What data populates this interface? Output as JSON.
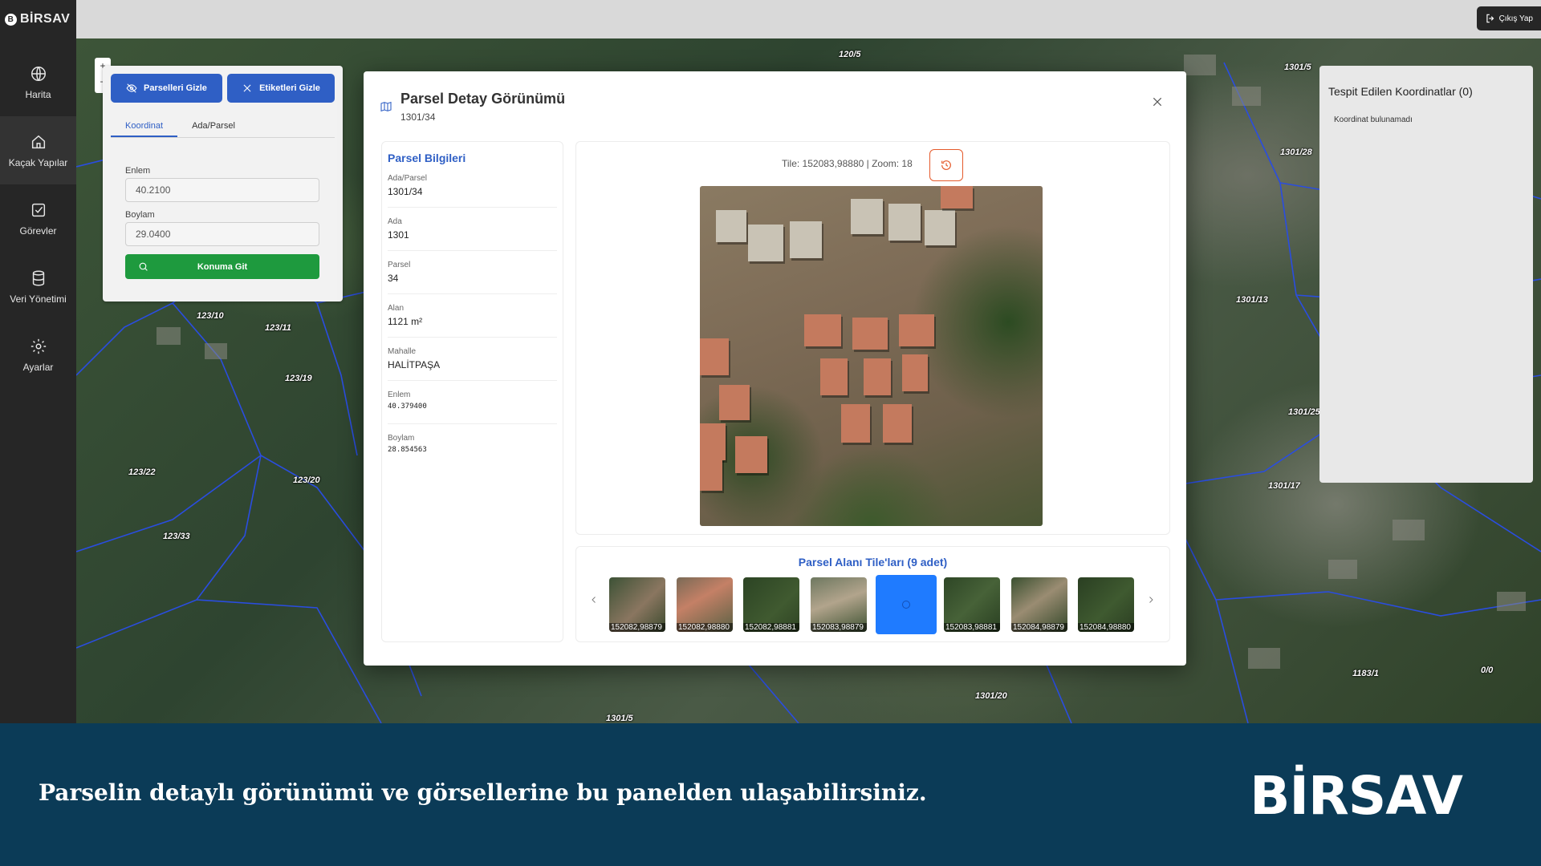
{
  "app": {
    "logo": "BİRSAV",
    "logout_label": "Çıkış Yap"
  },
  "sidebar": {
    "items": [
      {
        "label": "Harita",
        "icon": "globe-icon"
      },
      {
        "label": "Kaçak Yapılar",
        "icon": "home-icon"
      },
      {
        "label": "Görevler",
        "icon": "checkbox-icon"
      },
      {
        "label": "Veri Yönetimi",
        "icon": "database-icon"
      },
      {
        "label": "Ayarlar",
        "icon": "gear-icon"
      }
    ]
  },
  "map": {
    "labels": [
      "120/5",
      "1301/5",
      "1301/28",
      "1301/13",
      "1301/25",
      "1301/17",
      "123/10",
      "123/11",
      "123/19",
      "123/22",
      "123/20",
      "123/33",
      "1301/20",
      "1183/1",
      "0/0",
      "1301/5"
    ]
  },
  "search_panel": {
    "hide_parcels_label": "Parselleri Gizle",
    "hide_labels_label": "Etiketleri Gizle",
    "tabs": [
      "Koordinat",
      "Ada/Parsel"
    ],
    "lat_label": "Enlem",
    "lat_value": "40.2100",
    "lon_label": "Boylam",
    "lon_value": "29.0400",
    "go_label": "Konuma Git"
  },
  "coord_panel": {
    "title": "Tespit Edilen Koordinatlar (0)",
    "empty_text": "Koordinat bulunamadı"
  },
  "modal": {
    "title": "Parsel Detay Görünümü",
    "subtitle": "1301/34",
    "info": {
      "heading": "Parsel Bilgileri",
      "fields": [
        {
          "key": "Ada/Parsel",
          "value": "1301/34"
        },
        {
          "key": "Ada",
          "value": "1301"
        },
        {
          "key": "Parsel",
          "value": "34"
        },
        {
          "key": "Alan",
          "value": "1121 m²"
        },
        {
          "key": "Mahalle",
          "value": "HALİTPAŞA"
        },
        {
          "key": "Enlem",
          "value": "40.379400"
        },
        {
          "key": "Boylam",
          "value": "28.854563"
        }
      ]
    },
    "tile_info": "Tile: 152083,98880 | Zoom: 18",
    "tiles_heading": "Parsel Alanı Tile'ları (9 adet)",
    "thumbs": [
      "152082,98879",
      "152082,98880",
      "152082,98881",
      "152083,98879",
      "",
      "152083,98881",
      "152084,98879",
      "152084,98880"
    ]
  },
  "footer": {
    "caption": "Parselin detaylı görünümü ve görsellerine bu panelden ulaşabilirsiniz.",
    "brand": "BİRSAV"
  }
}
